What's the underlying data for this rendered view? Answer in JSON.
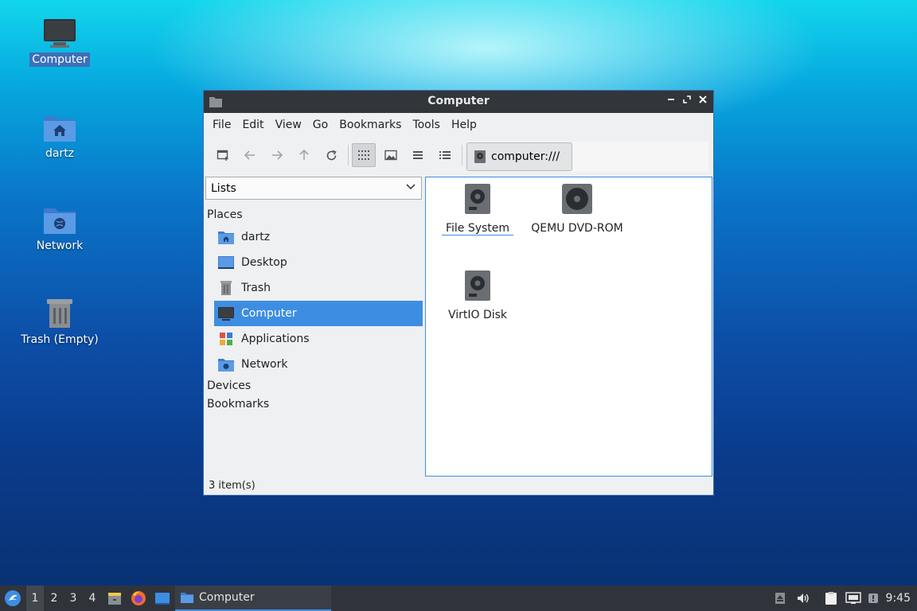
{
  "desktop": {
    "icons": [
      {
        "label": "Computer"
      },
      {
        "label": "dartz"
      },
      {
        "label": "Network"
      },
      {
        "label": "Trash (Empty)"
      }
    ]
  },
  "window": {
    "title": "Computer",
    "menu": [
      "File",
      "Edit",
      "View",
      "Go",
      "Bookmarks",
      "Tools",
      "Help"
    ],
    "path": "computer:///",
    "sidebar": {
      "mode": "Lists",
      "sections": {
        "places": "Places",
        "devices": "Devices",
        "bookmarks": "Bookmarks"
      },
      "places": [
        {
          "label": "dartz",
          "icon": "home-folder-icon"
        },
        {
          "label": "Desktop",
          "icon": "desktop-icon"
        },
        {
          "label": "Trash",
          "icon": "trash-icon"
        },
        {
          "label": "Computer",
          "icon": "computer-icon",
          "selected": true
        },
        {
          "label": "Applications",
          "icon": "applications-icon"
        },
        {
          "label": "Network",
          "icon": "network-folder-icon"
        }
      ]
    },
    "items": [
      {
        "label": "File System",
        "icon": "drive-icon"
      },
      {
        "label": "QEMU DVD-ROM",
        "icon": "optical-drive-icon"
      },
      {
        "label": "VirtIO Disk",
        "icon": "drive-icon"
      }
    ],
    "status": "3 item(s)"
  },
  "taskbar": {
    "workspaces": [
      "1",
      "2",
      "3",
      "4"
    ],
    "active_task": "Computer",
    "clock": "9:45"
  },
  "colors": {
    "accent": "#3d8ee2",
    "titlebar": "#32363a",
    "taskbar": "#30343a"
  }
}
